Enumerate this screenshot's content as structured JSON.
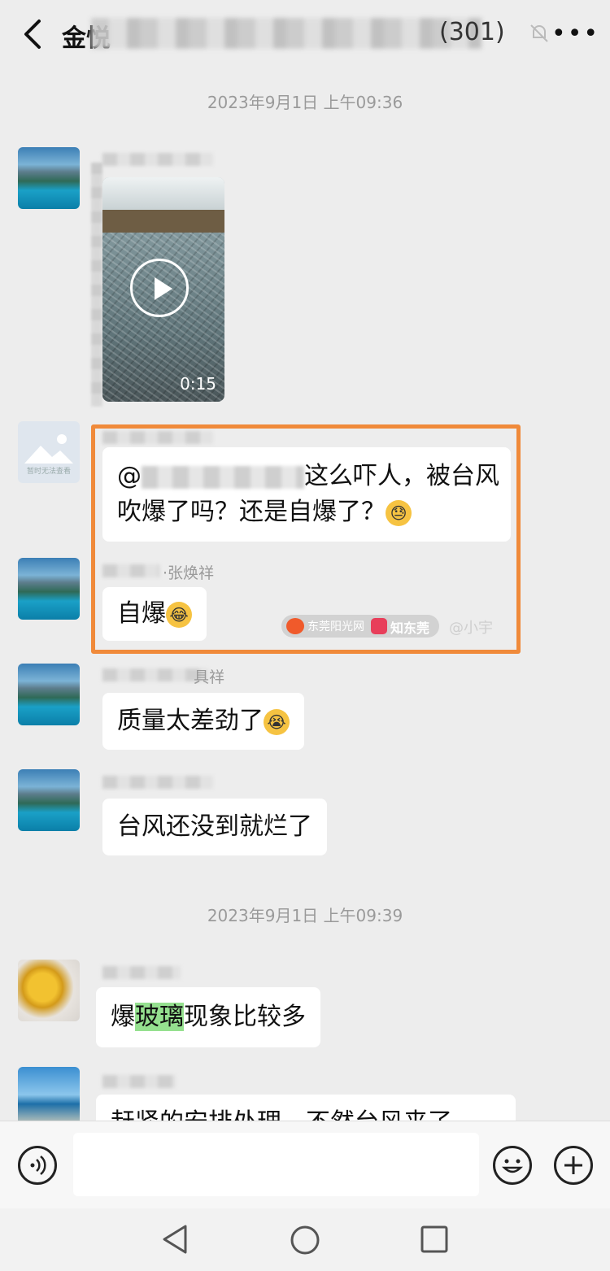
{
  "header": {
    "title_visible": "金悦",
    "member_count": "(301)"
  },
  "timestamps": [
    "2023年9月1日 上午09:36",
    "2023年9月1日 上午09:39"
  ],
  "video": {
    "duration": "0:15"
  },
  "messages": {
    "m2_prefix": "@",
    "m2_text_line1": "这么吓人，被台风",
    "m2_text_line2": "吹爆了吗？还是自爆了？",
    "m2_emoji": "😓",
    "m3_sender_partial": "·张焕祥",
    "m3_text": "自爆",
    "m3_emoji": "😂",
    "m4_sender_partial": "具祥",
    "m4_text": "质量太差劲了",
    "m4_emoji": "😭",
    "m5_text": "台风还没到就烂了",
    "m6_text_before": "爆",
    "m6_text_highlight": "玻璃",
    "m6_text_after": "现象比较多",
    "m7_text_partial": "赶紧的安排处理，不然台风来了"
  },
  "avatar_placeholder_text": "暂时无法查看",
  "watermark": {
    "site1": "东莞阳光网",
    "site2": "知东莞",
    "user": "@小宇"
  },
  "input_bar": {
    "voice_icon": "voice-icon",
    "emoji_icon": "smiley-icon",
    "plus_icon": "plus-icon"
  },
  "nav": [
    "back-triangle-icon",
    "home-circle-icon",
    "recents-square-icon"
  ],
  "colors": {
    "highlight_border": "#f08a3a",
    "text_highlight": "#95e08f",
    "background": "#ededed"
  }
}
